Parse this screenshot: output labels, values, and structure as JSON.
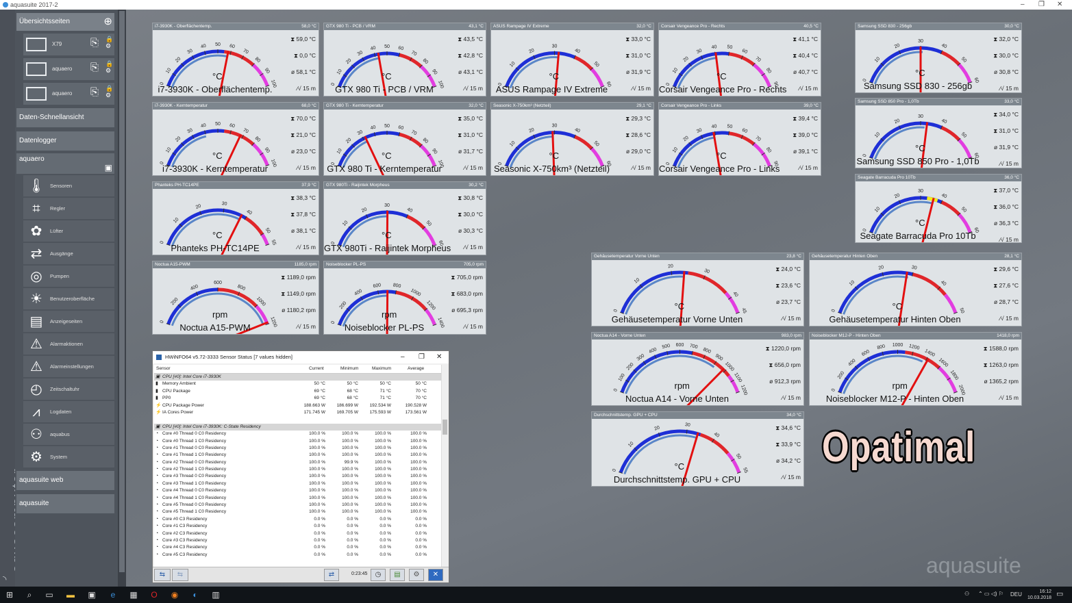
{
  "window": {
    "title": "aquasuite 2017-2",
    "minimize": "–",
    "maximize": "❐",
    "close": "✕"
  },
  "brand": "aquacomputer",
  "watermark": "aquasuite",
  "overlay_text": "Opatimal",
  "sidebar": {
    "overview": "Übersichtsseiten",
    "devices": [
      {
        "label": "X79"
      },
      {
        "label": "aquaero"
      },
      {
        "label": "aquaero"
      }
    ],
    "quickview": "Daten-Schnellansicht",
    "datalogger": "Datenlogger",
    "aquaero": "aquaero",
    "menu": [
      {
        "label": "Sensoren",
        "icon": "thermometer-icon",
        "glyph": "🌡"
      },
      {
        "label": "Regler",
        "icon": "controller-icon",
        "glyph": "⌗"
      },
      {
        "label": "Lüfter",
        "icon": "fan-icon",
        "glyph": "✿"
      },
      {
        "label": "Ausgänge",
        "icon": "outputs-icon",
        "glyph": "⇄"
      },
      {
        "label": "Pumpen",
        "icon": "pump-icon",
        "glyph": "◎"
      },
      {
        "label": "Benutzeroberfläche",
        "icon": "ui-icon",
        "glyph": "☀"
      },
      {
        "label": "Anzeigeseiten",
        "icon": "display-pages-icon",
        "glyph": "▤"
      },
      {
        "label": "Alarmaktionen",
        "icon": "alarm-actions-icon",
        "glyph": "⚠"
      },
      {
        "label": "Alarmeinstellungen",
        "icon": "alarm-settings-icon",
        "glyph": "⚠"
      },
      {
        "label": "Zeitschaltuhr",
        "icon": "timer-icon",
        "glyph": "◴"
      },
      {
        "label": "Logdaten",
        "icon": "log-data-icon",
        "glyph": "⩘"
      },
      {
        "label": "aquabus",
        "icon": "aquabus-icon",
        "glyph": "⚇"
      },
      {
        "label": "System",
        "icon": "system-icon",
        "glyph": "⚙"
      }
    ],
    "web": "aquasuite web",
    "aquasuite": "aquasuite"
  },
  "gauges": [
    {
      "id": "g1",
      "header": "i7-3930K - Oberflächentemp.",
      "value": "58,0 °C",
      "title": "i7-3930K - Oberflächentemp.",
      "unit": "°C",
      "max": "59,0 °C",
      "min": "0,0 °C",
      "avg": "58,1 °C",
      "time": "15 m",
      "ticks": [
        "0",
        "10",
        "20",
        "30",
        "40",
        "50",
        "60",
        "70",
        "80",
        "90",
        "100"
      ],
      "lo": 0,
      "hi": 100,
      "val": 58,
      "red": 55,
      "mag": 80,
      "avgv": 58
    },
    {
      "id": "g2",
      "header": "GTX 980 Ti - PCB / VRM",
      "value": "43,1 °C",
      "title": "GTX 980 Ti - PCB / VRM",
      "unit": "°C",
      "max": "43,5 °C",
      "min": "42,8 °C",
      "avg": "43,1 °C",
      "time": "15 m",
      "ticks": [
        "0",
        "10",
        "20",
        "30",
        "40",
        "50",
        "60",
        "70",
        "80",
        "90",
        "100"
      ],
      "lo": 0,
      "hi": 100,
      "val": 43,
      "red": 60,
      "mag": 80,
      "avgv": 43
    },
    {
      "id": "g3",
      "header": "ASUS Rampage IV Extreme",
      "value": "32,0 °C",
      "title": "ASUS Rampage IV Extreme",
      "unit": "°C",
      "max": "33,0 °C",
      "min": "31,0 °C",
      "avg": "31,9 °C",
      "time": "15 m",
      "ticks": [
        "0",
        "10",
        "20",
        "30",
        "40",
        "50",
        "60"
      ],
      "lo": 0,
      "hi": 60,
      "val": 32,
      "red": 40,
      "mag": 50,
      "avgv": 32
    },
    {
      "id": "g4",
      "header": "Corsair Vengeance Pro - Rechts",
      "value": "40,5 °C",
      "title": "Corsair Vengeance Pro - Rechts",
      "unit": "°C",
      "max": "41,1 °C",
      "min": "40,4 °C",
      "avg": "40,7 °C",
      "time": "15 m",
      "ticks": [
        "0",
        "10",
        "20",
        "30",
        "40",
        "50",
        "60",
        "70",
        "80",
        "90"
      ],
      "lo": 0,
      "hi": 90,
      "val": 40.5,
      "red": 50,
      "mag": 70,
      "avgv": 40.7
    },
    {
      "id": "g5",
      "header": "Samsung SSD 830 - 256gb",
      "value": "30,0 °C",
      "title": "Samsung SSD 830 - 256gb",
      "unit": "°C",
      "max": "32,0 °C",
      "min": "30,0 °C",
      "avg": "30,8 °C",
      "time": "15 m",
      "ticks": [
        "0",
        "10",
        "20",
        "30",
        "40",
        "50",
        "60"
      ],
      "lo": 0,
      "hi": 60,
      "val": 30,
      "red": 40,
      "mag": 50,
      "avgv": 31
    },
    {
      "id": "g6",
      "header": "i7-3930K - Kerntemperatur",
      "value": "68,0 °C",
      "title": "i7-3930K - Kerntemperatur",
      "unit": "°C",
      "max": "70,0 °C",
      "min": "21,0 °C",
      "avg": "23,0 °C",
      "time": "15 m",
      "ticks": [
        "0",
        "10",
        "20",
        "30",
        "40",
        "50",
        "60",
        "70",
        "80",
        "90",
        "100"
      ],
      "lo": 0,
      "hi": 100,
      "val": 68,
      "red": 55,
      "mag": 80,
      "avgv": 40
    },
    {
      "id": "g7",
      "header": "GTX 980 Ti - Kerntemperatur",
      "value": "32,0 °C",
      "title": "GTX 980 Ti - Kerntemperatur",
      "unit": "°C",
      "max": "35,0 °C",
      "min": "31,0 °C",
      "avg": "31,7 °C",
      "time": "15 m",
      "ticks": [
        "0",
        "10",
        "20",
        "30",
        "40",
        "50",
        "60",
        "70",
        "80",
        "90",
        "100"
      ],
      "lo": 0,
      "hi": 100,
      "val": 32,
      "red": 60,
      "mag": 80,
      "avgv": 32
    },
    {
      "id": "g8",
      "header": "Seasonic X-750km³ (Netzteil)",
      "value": "29,1 °C",
      "title": "Seasonic X-750km³ (Netzteil)",
      "unit": "°C",
      "max": "29,3 °C",
      "min": "28,6 °C",
      "avg": "29,0 °C",
      "time": "15 m",
      "ticks": [
        "0",
        "10",
        "20",
        "30",
        "40",
        "50",
        "60"
      ],
      "lo": 0,
      "hi": 60,
      "val": 29.1,
      "red": 40,
      "mag": 50,
      "avgv": 29
    },
    {
      "id": "g9",
      "header": "Corsair Vengeance Pro - Links",
      "value": "39,0 °C",
      "title": "Corsair Vengeance Pro - Links",
      "unit": "°C",
      "max": "39,4 °C",
      "min": "39,0 °C",
      "avg": "39,1 °C",
      "time": "15 m",
      "ticks": [
        "0",
        "10",
        "20",
        "30",
        "40",
        "50",
        "60",
        "70",
        "80",
        "90"
      ],
      "lo": 0,
      "hi": 90,
      "val": 39,
      "red": 50,
      "mag": 70,
      "avgv": 39
    },
    {
      "id": "g10",
      "header": "Samsung SSD 850 Pro - 1,0Tb",
      "value": "33,0 °C",
      "title": "Samsung SSD 850 Pro - 1,0Tb",
      "unit": "°C",
      "max": "34,0 °C",
      "min": "31,0 °C",
      "avg": "31,9 °C",
      "time": "15 m",
      "ticks": [
        "0",
        "10",
        "20",
        "30",
        "40",
        "50",
        "60"
      ],
      "lo": 0,
      "hi": 60,
      "val": 33,
      "red": 40,
      "mag": 50,
      "avgv": 32
    },
    {
      "id": "g11",
      "header": "Phanteks PH-TC14PE",
      "value": "37,9 °C",
      "title": "Phanteks PH-TC14PE",
      "unit": "°C",
      "max": "38,3 °C",
      "min": "37,8 °C",
      "avg": "38,1 °C",
      "time": "15 m",
      "ticks": [
        "0",
        "10",
        "20",
        "30",
        "40",
        "50",
        "55"
      ],
      "lo": 0,
      "hi": 55,
      "val": 37.9,
      "red": 40,
      "mag": 50,
      "avgv": 38
    },
    {
      "id": "g12",
      "header": "GTX 980Ti - Raijintek Morpheus",
      "value": "30,2 °C",
      "title": "GTX 980Ti - Raijintek Morpheus",
      "unit": "°C",
      "max": "30,8 °C",
      "min": "30,0 °C",
      "avg": "30,3 °C",
      "time": "15 m",
      "ticks": [
        "0",
        "10",
        "20",
        "30",
        "40",
        "50",
        "60"
      ],
      "lo": 0,
      "hi": 60,
      "val": 30.2,
      "red": 40,
      "mag": 50,
      "avgv": 30
    },
    {
      "id": "g13",
      "header": "Seagate Barracuda Pro 10Tb",
      "value": "36,0 °C",
      "title": "Seagate Barracuda Pro 10Tb",
      "unit": "°C",
      "max": "37,0 °C",
      "min": "36,0 °C",
      "avg": "36,3 °C",
      "time": "15 m",
      "ticks": [
        "0",
        "10",
        "20",
        "30",
        "40",
        "50",
        "60"
      ],
      "lo": 0,
      "hi": 60,
      "val": 36,
      "red": 40,
      "mag": 50,
      "avgv": 36,
      "yellow": [
        33,
        38
      ]
    },
    {
      "id": "g14",
      "header": "Noctua A15-PWM",
      "value": "1185,0 rpm",
      "title": "Noctua A15-PWM",
      "unit": "rpm",
      "max": "1189,0 rpm",
      "min": "1149,0 rpm",
      "avg": "1180,2 rpm",
      "time": "15 m",
      "ticks": [
        "0",
        "200",
        "400",
        "600",
        "800",
        "1000",
        "1200"
      ],
      "lo": 0,
      "hi": 1200,
      "val": 1185,
      "red": 600,
      "mag": 1000,
      "avgv": 1180
    },
    {
      "id": "g15",
      "header": "Noiseblocker PL-PS",
      "value": "705,0 rpm",
      "title": "Noiseblocker PL-PS",
      "unit": "rpm",
      "max": "705,0 rpm",
      "min": "683,0 rpm",
      "avg": "695,3 rpm",
      "time": "15 m",
      "ticks": [
        "0",
        "200",
        "400",
        "600",
        "800",
        "1000",
        "1200",
        "1400"
      ],
      "lo": 0,
      "hi": 1400,
      "val": 705,
      "red": 800,
      "mag": 1200,
      "avgv": 695
    },
    {
      "id": "g16",
      "header": "Gehäusetemperatur Vorne Unten",
      "value": "23,8 °C",
      "title": "Gehäusetemperatur Vorne Unten",
      "unit": "°C",
      "max": "24,0 °C",
      "min": "23,6 °C",
      "avg": "23,7 °C",
      "time": "15 m",
      "ticks": [
        "0",
        "10",
        "20",
        "30",
        "40",
        "45"
      ],
      "lo": 0,
      "hi": 45,
      "val": 23.8,
      "red": 25,
      "mag": 38,
      "avgv": 23.7
    },
    {
      "id": "g17",
      "header": "Gehäusetemperatur Hinten Oben",
      "value": "28,1 °C",
      "title": "Gehäusetemperatur Hinten Oben",
      "unit": "°C",
      "max": "29,6 °C",
      "min": "27,6 °C",
      "avg": "28,7 °C",
      "time": "15 m",
      "ticks": [
        "0",
        "10",
        "20",
        "30",
        "40",
        "50"
      ],
      "lo": 0,
      "hi": 50,
      "val": 28.1,
      "red": 30,
      "mag": 43,
      "avgv": 28.7
    },
    {
      "id": "g18",
      "header": "Noctua A14 - Vorne Unten",
      "value": "983,0 rpm",
      "title": "Noctua A14 - Vorne Unten",
      "unit": "rpm",
      "max": "1220,0 rpm",
      "min": "656,0 rpm",
      "avg": "912,3 rpm",
      "time": "15 m",
      "ticks": [
        "0",
        "100",
        "200",
        "300",
        "400",
        "500",
        "600",
        "700",
        "800",
        "900",
        "1000",
        "1100",
        "1200"
      ],
      "lo": 0,
      "hi": 1200,
      "val": 983,
      "red": 700,
      "mag": 1050,
      "avgv": 912
    },
    {
      "id": "g19",
      "header": "Noiseblocker M12-P - Hinten Oben",
      "value": "1418,0 rpm",
      "title": "Noiseblocker M12-P - Hinten Oben",
      "unit": "rpm",
      "max": "1588,0 rpm",
      "min": "1263,0 rpm",
      "avg": "1365,2 rpm",
      "time": "15 m",
      "ticks": [
        "0",
        "200",
        "400",
        "600",
        "800",
        "1000",
        "1200",
        "1400",
        "1600",
        "1800",
        "2000"
      ],
      "lo": 0,
      "hi": 2000,
      "val": 1418,
      "red": 1100,
      "mag": 1600,
      "avgv": 1365
    },
    {
      "id": "g20",
      "header": "Durchschnittstemp. GPU + CPU",
      "value": "34,0 °C",
      "title": "Durchschnittstemp. GPU + CPU",
      "unit": "°C",
      "max": "34,6 °C",
      "min": "33,9 °C",
      "avg": "34,2 °C",
      "time": "15 m",
      "ticks": [
        "0",
        "10",
        "20",
        "30",
        "40",
        "50",
        "55"
      ],
      "lo": 0,
      "hi": 55,
      "val": 34,
      "red": 35,
      "mag": 47,
      "avgv": 34
    }
  ],
  "hwinfo": {
    "title": "HWiNFO64 v5.72-3333 Sensor Status [7 values hidden]",
    "cols": [
      "Sensor",
      "Current",
      "Minimum",
      "Maximum",
      "Average"
    ],
    "rows": [
      [
        "CPU [#0]: Intel Core i7-3930K",
        "",
        "",
        "",
        ""
      ],
      [
        "Memory Ambient",
        "50 °C",
        "50 °C",
        "50 °C",
        "50 °C"
      ],
      [
        "CPU Package",
        "69 °C",
        "68 °C",
        "71 °C",
        "70 °C"
      ],
      [
        "PP0",
        "69 °C",
        "68 °C",
        "71 °C",
        "70 °C"
      ],
      [
        "CPU Package Power",
        "188.663 W",
        "186.699 W",
        "192.534 W",
        "190.528 W"
      ],
      [
        "IA Cores Power",
        "171.745 W",
        "169.705 W",
        "175.593 W",
        "173.561 W"
      ],
      [
        "",
        "",
        "",
        "",
        ""
      ],
      [
        "CPU [#0]: Intel Core i7-3930K: C-State Residency",
        "",
        "",
        "",
        ""
      ],
      [
        "Core #0 Thread 0 C0 Residency",
        "100.0 %",
        "100.0 %",
        "100.0 %",
        "100.0 %"
      ],
      [
        "Core #0 Thread 1 C0 Residency",
        "100.0 %",
        "100.0 %",
        "100.0 %",
        "100.0 %"
      ],
      [
        "Core #1 Thread 0 C0 Residency",
        "100.0 %",
        "100.0 %",
        "100.0 %",
        "100.0 %"
      ],
      [
        "Core #1 Thread 1 C0 Residency",
        "100.0 %",
        "100.0 %",
        "100.0 %",
        "100.0 %"
      ],
      [
        "Core #2 Thread 0 C0 Residency",
        "100.0 %",
        "99.9 %",
        "100.0 %",
        "100.0 %"
      ],
      [
        "Core #2 Thread 1 C0 Residency",
        "100.0 %",
        "100.0 %",
        "100.0 %",
        "100.0 %"
      ],
      [
        "Core #3 Thread 0 C0 Residency",
        "100.0 %",
        "100.0 %",
        "100.0 %",
        "100.0 %"
      ],
      [
        "Core #3 Thread 1 C0 Residency",
        "100.0 %",
        "100.0 %",
        "100.0 %",
        "100.0 %"
      ],
      [
        "Core #4 Thread 0 C0 Residency",
        "100.0 %",
        "100.0 %",
        "100.0 %",
        "100.0 %"
      ],
      [
        "Core #4 Thread 1 C0 Residency",
        "100.0 %",
        "100.0 %",
        "100.0 %",
        "100.0 %"
      ],
      [
        "Core #5 Thread 0 C0 Residency",
        "100.0 %",
        "100.0 %",
        "100.0 %",
        "100.0 %"
      ],
      [
        "Core #5 Thread 1 C0 Residency",
        "100.0 %",
        "100.0 %",
        "100.0 %",
        "100.0 %"
      ],
      [
        "Core #0 C3 Residency",
        "0.0 %",
        "0.0 %",
        "0.0 %",
        "0.0 %"
      ],
      [
        "Core #1 C3 Residency",
        "0.0 %",
        "0.0 %",
        "0.0 %",
        "0.0 %"
      ],
      [
        "Core #2 C3 Residency",
        "0.0 %",
        "0.0 %",
        "0.0 %",
        "0.0 %"
      ],
      [
        "Core #3 C3 Residency",
        "0.0 %",
        "0.0 %",
        "0.0 %",
        "0.0 %"
      ],
      [
        "Core #4 C3 Residency",
        "0.0 %",
        "0.0 %",
        "0.0 %",
        "0.0 %"
      ],
      [
        "Core #5 C3 Residency",
        "0.0 %",
        "0.0 %",
        "0.0 %",
        "0.0 %"
      ]
    ],
    "elapsed": "0:23:45"
  },
  "taskbar": {
    "lang": "DEU",
    "time": "16:12",
    "date": "10.03.2018"
  },
  "colors": {
    "blue": "#1e2fd6",
    "red": "#e0262a",
    "magenta": "#e23de0",
    "needle": "#e31010",
    "yellow": "#f2ee1e",
    "avg": "#5a86c8"
  }
}
